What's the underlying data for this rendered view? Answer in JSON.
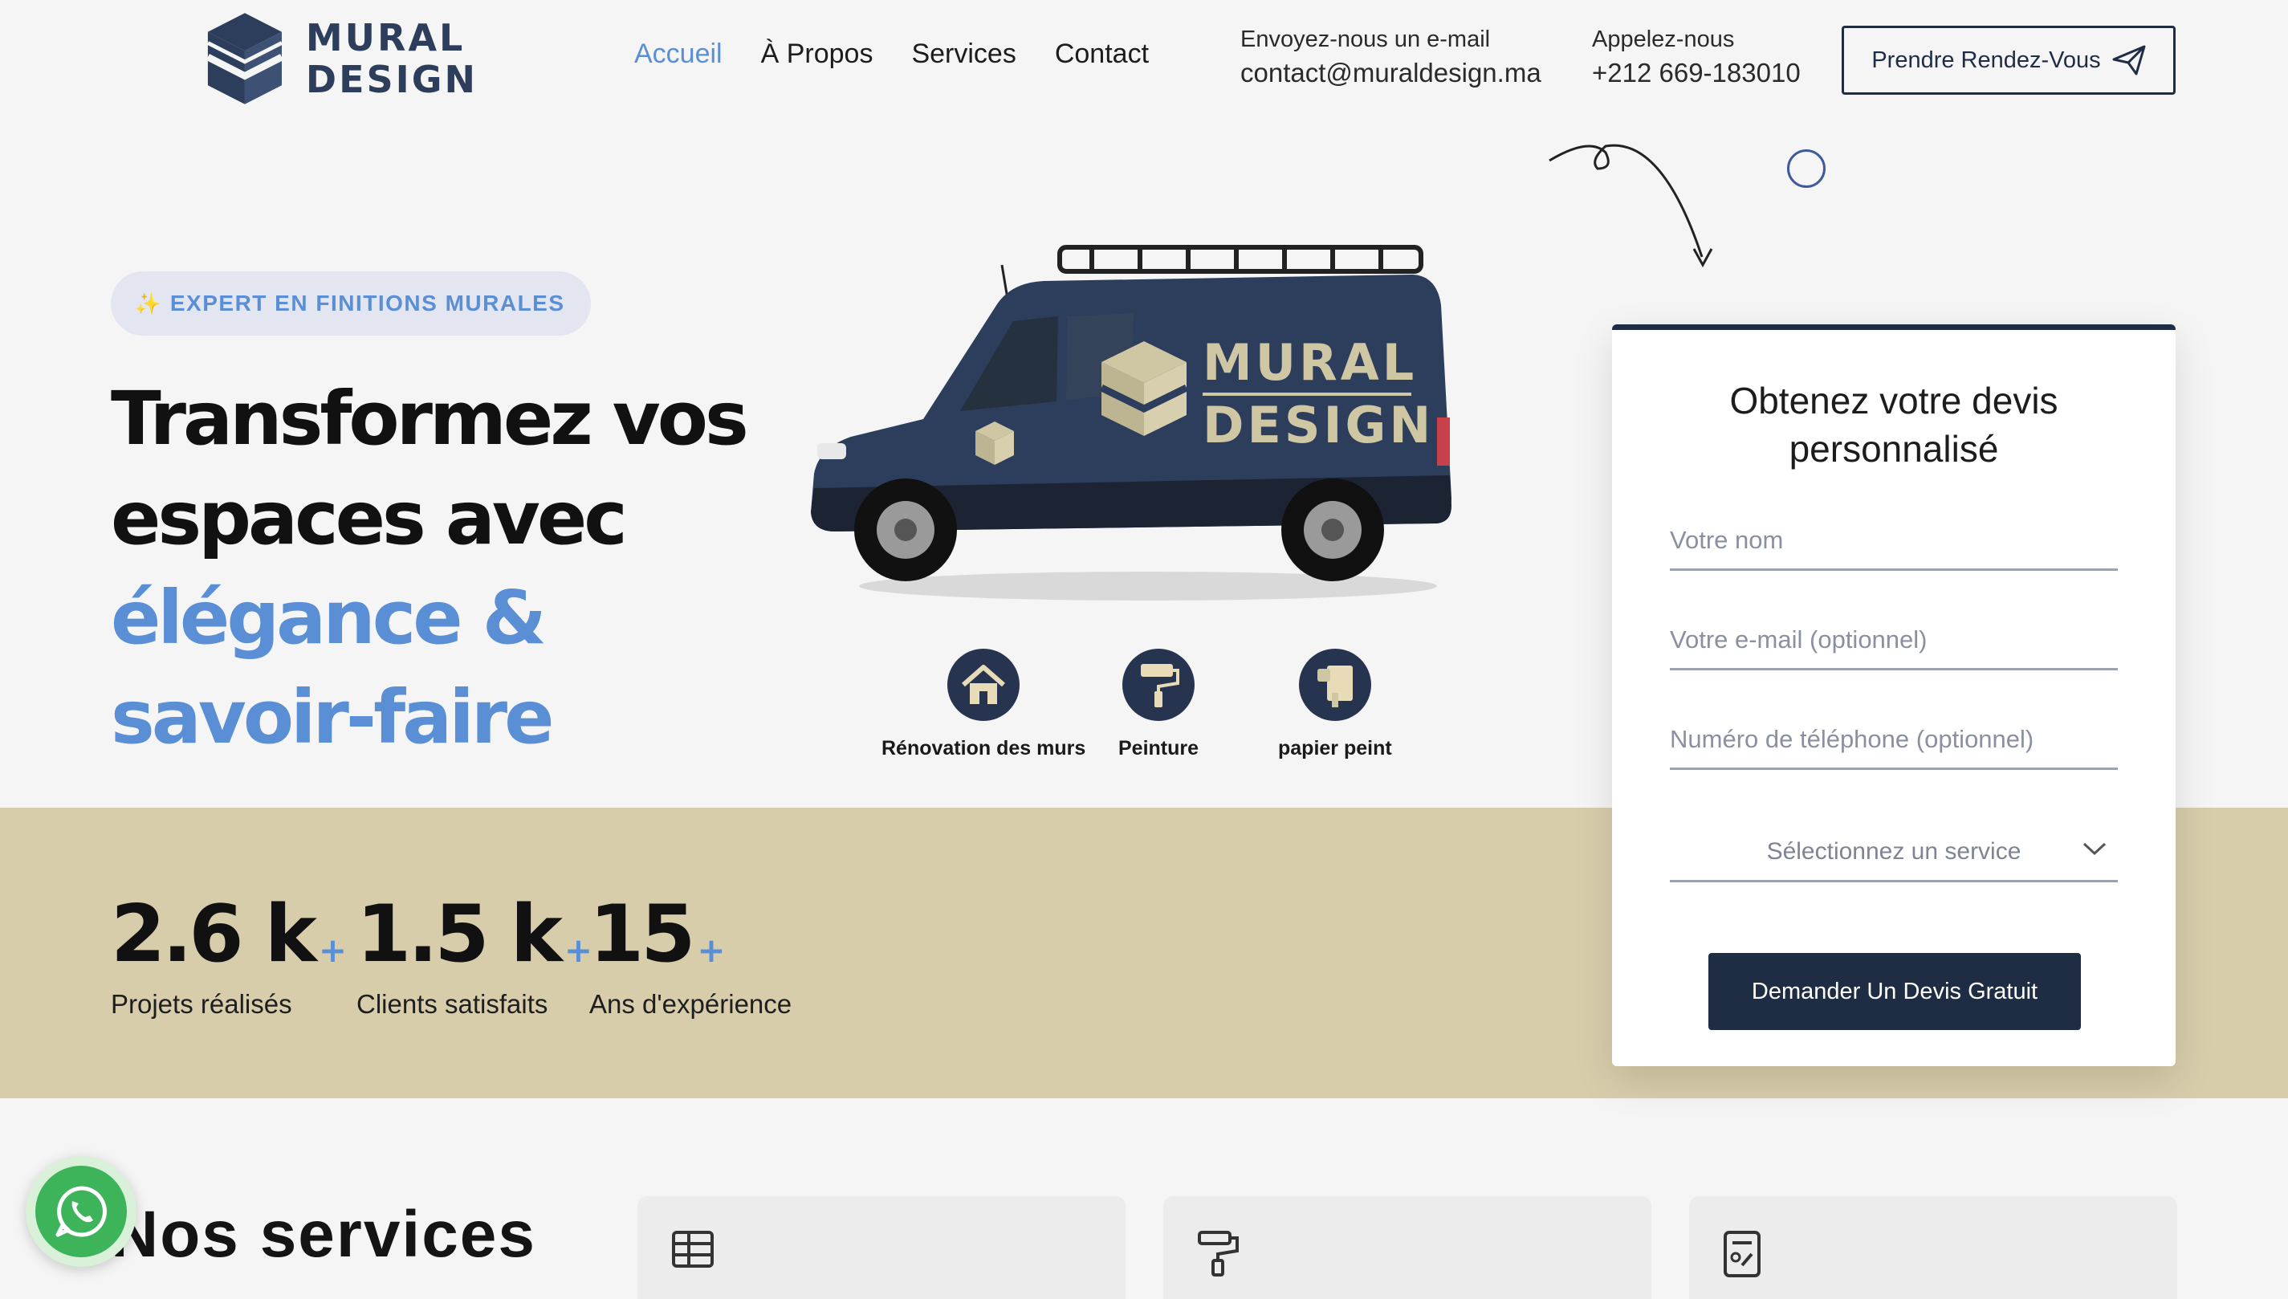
{
  "brand": {
    "line1": "MURAL",
    "line2": "DESIGN"
  },
  "nav": {
    "items": [
      "Accueil",
      "À Propos",
      "Services",
      "Contact"
    ],
    "active": 0
  },
  "contact": {
    "email_label": "Envoyez-nous un e-mail",
    "email_value": "contact@muraldesign.ma",
    "phone_label": "Appelez-nous",
    "phone_value": "+212 669-183010"
  },
  "header_cta": "Prendre Rendez-Vous",
  "hero": {
    "badge": "EXPERT EN FINITIONS MURALES",
    "title_line1": "Transformez vos",
    "title_line2": "espaces avec",
    "title_accent1": "élégance &",
    "title_accent2": "savoir-faire"
  },
  "mini_services": [
    {
      "label": "Rénovation des murs",
      "icon": "house-icon"
    },
    {
      "label": "Peinture",
      "icon": "paint-roller-icon"
    },
    {
      "label": "papier peint",
      "icon": "wallpaper-icon"
    }
  ],
  "stats": [
    {
      "value": "2.6 k",
      "suffix": "+",
      "label": "Projets réalisés"
    },
    {
      "value": "1.5 k",
      "suffix": "+",
      "label": "Clients satisfaits"
    },
    {
      "value": "15",
      "suffix": "+",
      "label": "Ans d'expérience"
    }
  ],
  "form": {
    "title": "Obtenez votre devis personnalisé",
    "name_placeholder": "Votre nom",
    "email_placeholder": "Votre e-mail (optionnel)",
    "phone_placeholder": "Numéro de téléphone (optionnel)",
    "service_placeholder": "Sélectionnez un service",
    "submit": "Demander Un Devis Gratuit"
  },
  "services_section": {
    "title": "Nos services"
  },
  "colors": {
    "navy": "#1f2d44",
    "accent_blue": "#5a8fd6",
    "band_beige": "#d8cdab",
    "whatsapp_green": "#3db35a"
  }
}
